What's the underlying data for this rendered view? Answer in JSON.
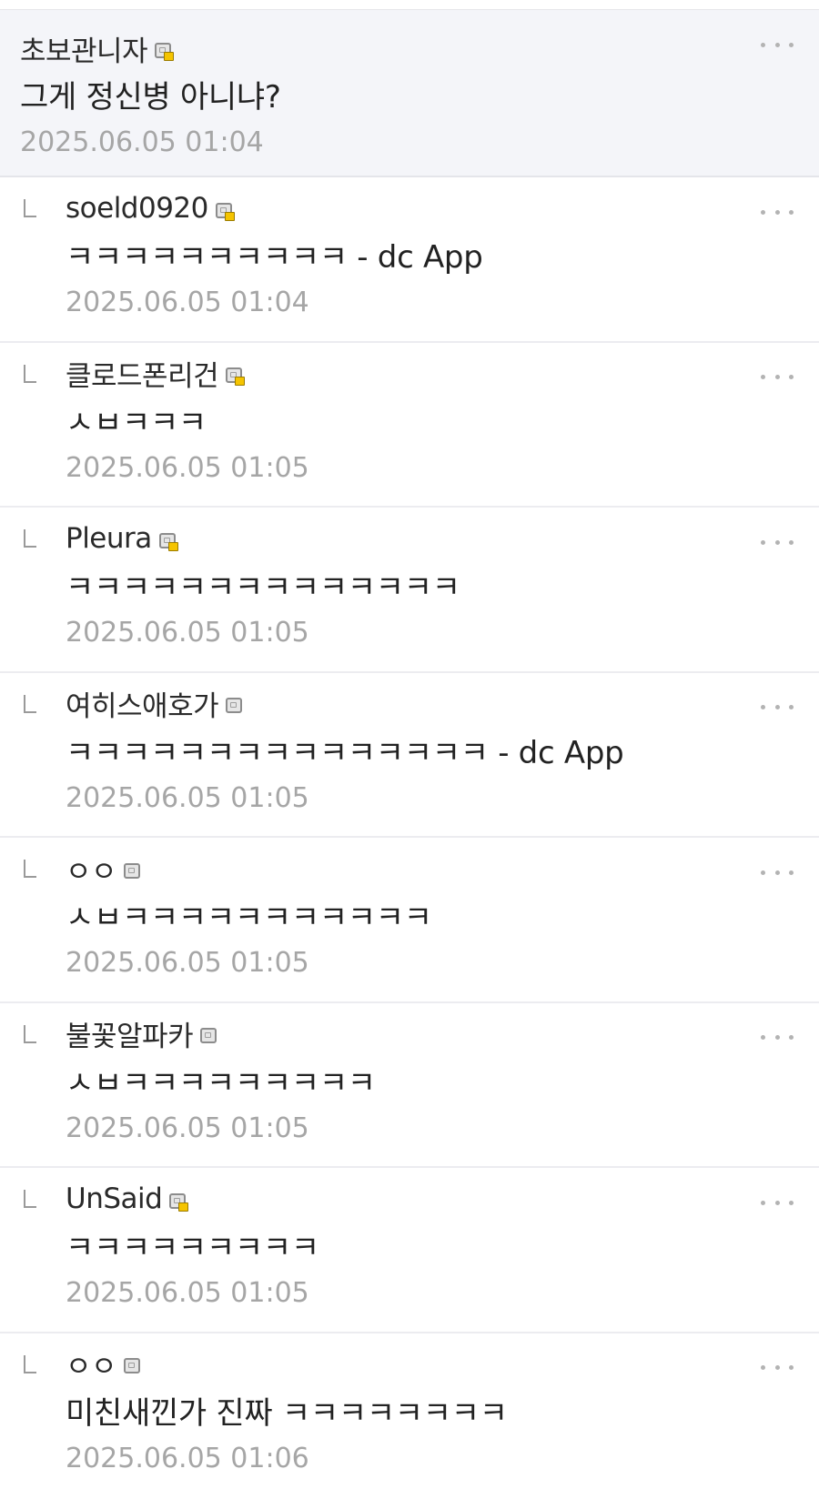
{
  "comments": [
    {
      "author": "초보관니자",
      "icon": "gallog-icon-fixed",
      "text": "그게 정신병 아니냐?",
      "time": "2025.06.05 01:04",
      "is_reply": false
    },
    {
      "author": "soeld0920",
      "icon": "gallog-icon-fixed",
      "text": "ㅋㅋㅋㅋㅋㅋㅋㅋㅋㅋ - dc App",
      "time": "2025.06.05 01:04",
      "is_reply": true
    },
    {
      "author": "클로드폰리건",
      "icon": "gallog-icon-fixed",
      "text": "ㅅㅂㅋㅋㅋ",
      "time": "2025.06.05 01:05",
      "is_reply": true
    },
    {
      "author": "Pleura",
      "icon": "gallog-icon-fixed",
      "text": "ㅋㅋㅋㅋㅋㅋㅋㅋㅋㅋㅋㅋㅋㅋ",
      "time": "2025.06.05 01:05",
      "is_reply": true
    },
    {
      "author": "여히스애호가",
      "icon": "gallog-icon",
      "text": "ㅋㅋㅋㅋㅋㅋㅋㅋㅋㅋㅋㅋㅋㅋㅋ - dc App",
      "time": "2025.06.05 01:05",
      "is_reply": true
    },
    {
      "author": "ㅇㅇ",
      "icon": "gallog-icon",
      "text": "ㅅㅂㅋㅋㅋㅋㅋㅋㅋㅋㅋㅋㅋ",
      "time": "2025.06.05 01:05",
      "is_reply": true
    },
    {
      "author": "불꽃알파카",
      "icon": "gallog-icon",
      "text": "ㅅㅂㅋㅋㅋㅋㅋㅋㅋㅋㅋ",
      "time": "2025.06.05 01:05",
      "is_reply": true
    },
    {
      "author": "UnSaid",
      "icon": "gallog-icon-fixed",
      "text": "ㅋㅋㅋㅋㅋㅋㅋㅋㅋ",
      "time": "2025.06.05 01:05",
      "is_reply": true
    },
    {
      "author": "ㅇㅇ",
      "icon": "gallog-icon",
      "text": "미친새낀가 진짜 ㅋㅋㅋㅋㅋㅋㅋㅋ",
      "time": "2025.06.05 01:06",
      "is_reply": true
    }
  ],
  "colors": {
    "root_background": "#f4f5f9",
    "divider": "#ececf0",
    "timestamp": "#a6a6a6",
    "fixed_badge": "#f5c400"
  }
}
